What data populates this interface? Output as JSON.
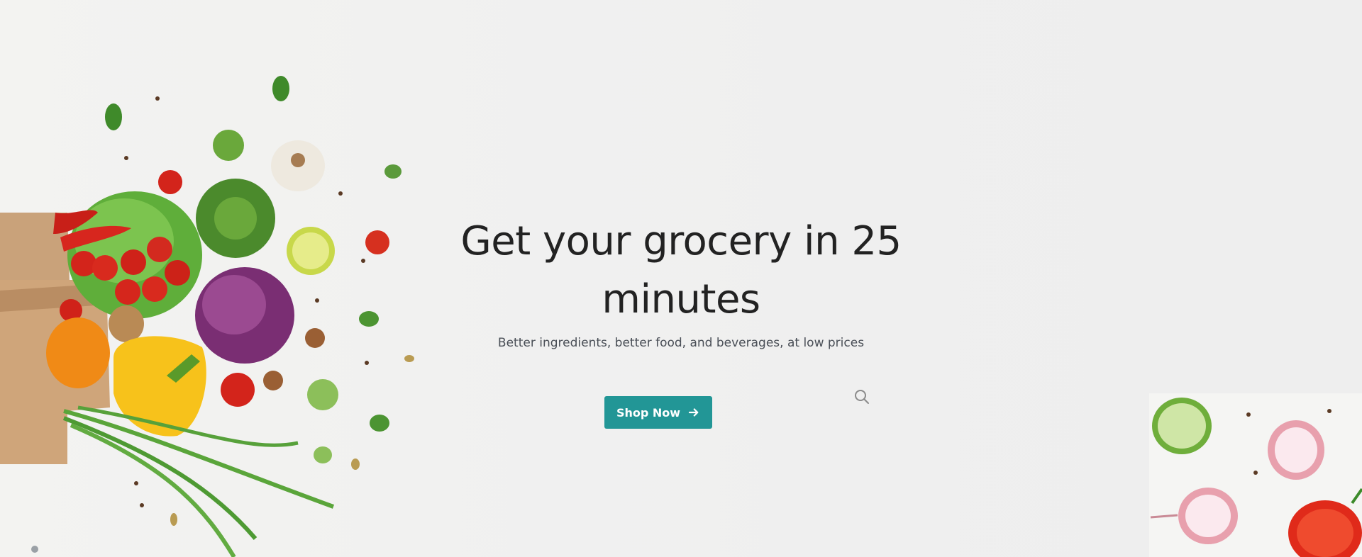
{
  "hero": {
    "headline": "Get your grocery in 25 minutes",
    "subtitle": "Better ingredients, better food, and beverages, at low prices",
    "cta_label": "Shop Now"
  },
  "icons": {
    "cta": "arrow-right-icon",
    "search": "search-icon"
  },
  "colors": {
    "accent": "#229696",
    "headline": "#222222",
    "subtitle": "#4a4f57",
    "background": "#efefef"
  }
}
